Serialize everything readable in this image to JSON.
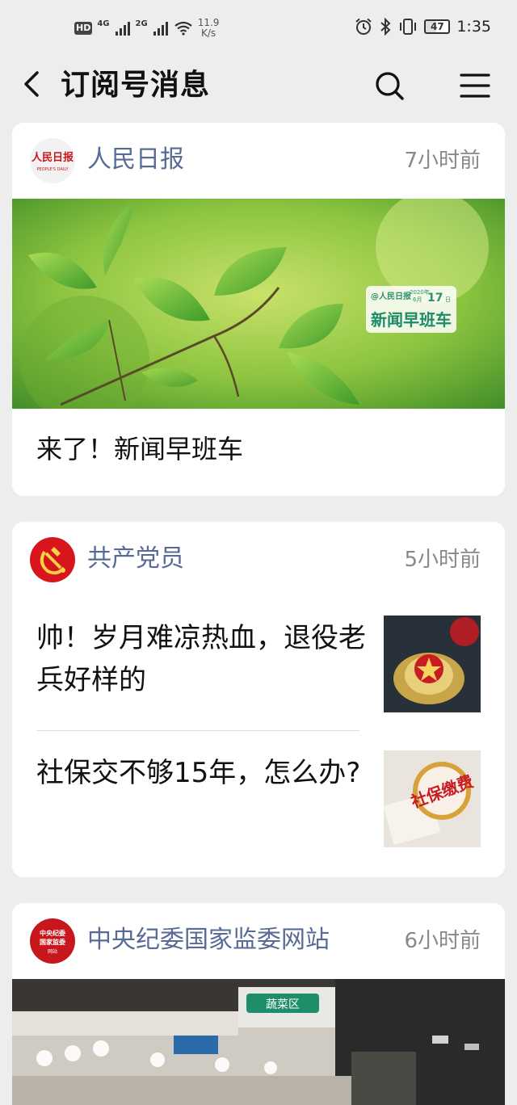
{
  "status_bar": {
    "left": {
      "hd": "HD",
      "sim1": "4G",
      "sim2": "2G",
      "speed_value": "11.9",
      "speed_unit": "K/s"
    },
    "right": {
      "battery": "47",
      "time": "1:35"
    }
  },
  "nav": {
    "title": "订阅号消息"
  },
  "cards": [
    {
      "account": "人民日报",
      "time": "7小时前",
      "logo_text": "人民日报",
      "logo_sub": "PEOPLE'S DAILY",
      "badge": {
        "brand": "@人民日报",
        "year": "2020年",
        "month": "6月",
        "day": "17",
        "day_suffix": "日",
        "label": "新闻早班车"
      },
      "headline": "来了！新闻早班车"
    },
    {
      "account": "共产党员",
      "time": "5小时前",
      "articles": [
        {
          "title": "帅！岁月难凉热血，退役老兵好样的"
        },
        {
          "title": "社保交不够15年，怎么办?",
          "thumb_text": "社保缴费"
        }
      ]
    },
    {
      "account": "中央纪委国家监委网站",
      "time": "6小时前",
      "logo_line1": "中央纪委",
      "logo_line2": "国家监委",
      "logo_line3": "网站",
      "sign_text": "蔬菜区"
    }
  ],
  "colors": {
    "account_name": "#576b95",
    "time": "#888888",
    "background": "#ededed"
  },
  "icons": [
    "back-arrow-icon",
    "search-icon",
    "menu-icon",
    "alarm-icon",
    "bluetooth-icon",
    "vibrate-icon",
    "wifi-icon",
    "signal-icon"
  ]
}
